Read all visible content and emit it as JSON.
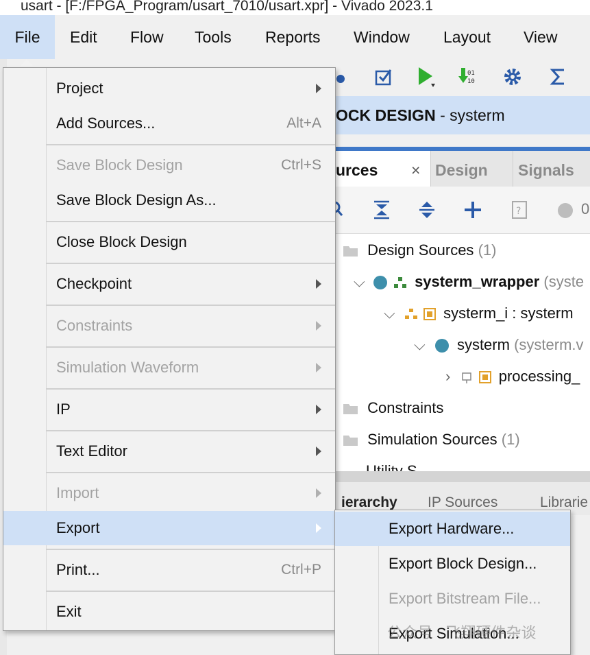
{
  "window": {
    "title": "usart - [F:/FPGA_Program/usart_7010/usart.xpr] - Vivado 2023.1"
  },
  "menubar": {
    "items": [
      "File",
      "Edit",
      "Flow",
      "Tools",
      "Reports",
      "Window",
      "Layout",
      "View"
    ],
    "active": "File"
  },
  "header": {
    "title_bold": "OCK DESIGN",
    "title_rest": " - systerm"
  },
  "panel": {
    "tabs": {
      "sources": "urces",
      "design": "Design",
      "signals": "Signals"
    },
    "status_count": "0"
  },
  "tree": {
    "design_sources": {
      "label": "Design Sources",
      "count": "(1)"
    },
    "wrapper": {
      "label": "systerm_wrapper",
      "extra": "(syste"
    },
    "instance": {
      "label": "systerm_i : systerm"
    },
    "systerm": {
      "label": "systerm",
      "extra": "(systerm.v"
    },
    "processing": {
      "label": "processing_"
    },
    "constraints": {
      "label": "Constraints"
    },
    "sim_sources": {
      "label": "Simulation Sources",
      "count": "(1)"
    },
    "utility": {
      "label": "Utility S"
    }
  },
  "bottom_tabs": [
    "ierarchy",
    "IP Sources",
    "Librarie"
  ],
  "file_menu": {
    "items": [
      {
        "label": "Project",
        "shortcut": "",
        "submenu": true,
        "enabled": true
      },
      {
        "label": "Add Sources...",
        "shortcut": "Alt+A",
        "submenu": false,
        "enabled": true
      },
      {
        "label": "Save Block Design",
        "shortcut": "Ctrl+S",
        "submenu": false,
        "enabled": false
      },
      {
        "label": "Save Block Design As...",
        "shortcut": "",
        "submenu": false,
        "enabled": true
      },
      {
        "label": "Close Block Design",
        "shortcut": "",
        "submenu": false,
        "enabled": true
      },
      {
        "label": "Checkpoint",
        "shortcut": "",
        "submenu": true,
        "enabled": true
      },
      {
        "label": "Constraints",
        "shortcut": "",
        "submenu": true,
        "enabled": false
      },
      {
        "label": "Simulation Waveform",
        "shortcut": "",
        "submenu": true,
        "enabled": false
      },
      {
        "label": "IP",
        "shortcut": "",
        "submenu": true,
        "enabled": true
      },
      {
        "label": "Text Editor",
        "shortcut": "",
        "submenu": true,
        "enabled": true
      },
      {
        "label": "Import",
        "shortcut": "",
        "submenu": true,
        "enabled": false
      },
      {
        "label": "Export",
        "shortcut": "",
        "submenu": true,
        "enabled": true,
        "highlighted": true
      },
      {
        "label": "Print...",
        "shortcut": "Ctrl+P",
        "submenu": false,
        "enabled": true
      },
      {
        "label": "Exit",
        "shortcut": "",
        "submenu": false,
        "enabled": true
      }
    ]
  },
  "export_submenu": {
    "items": [
      {
        "label": "Export Hardware...",
        "enabled": true,
        "highlighted": true
      },
      {
        "label": "Export Block Design...",
        "enabled": true
      },
      {
        "label": "Export Bitstream File...",
        "enabled": false
      },
      {
        "label": "Export Simulation...",
        "enabled": true
      }
    ]
  },
  "watermark": "公众号 · 飞翔硬件杂谈",
  "colors": {
    "highlight": "#cfe0f6",
    "accent_blue": "#3f78c8",
    "disabled_text": "#a3a3a3"
  }
}
